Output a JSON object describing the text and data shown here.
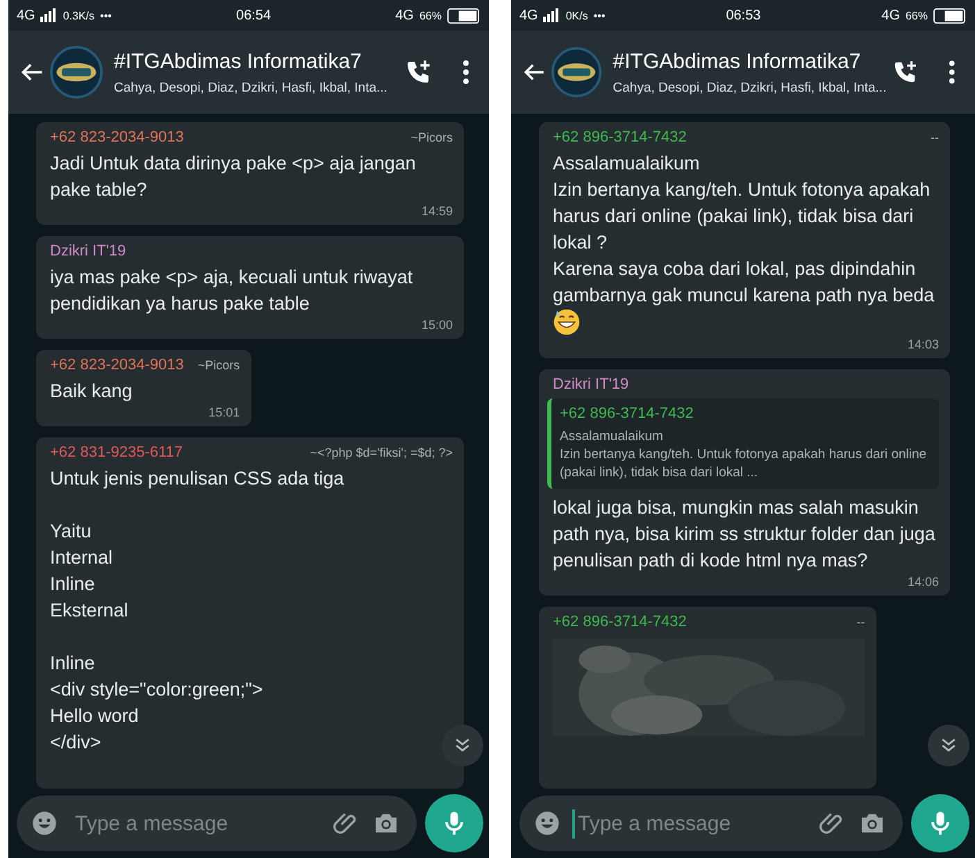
{
  "phones": [
    {
      "status_bar": {
        "network": "4G",
        "speed": "0.3K/s",
        "dots": "•••",
        "time": "06:54",
        "network_right": "4G",
        "battery": "66%"
      },
      "header": {
        "title": "#ITGAbdimas Informatika7",
        "subtitle": "Cahya, Desopi, Diaz, Dzikri, Hasfi, Ikbal, Inta..."
      },
      "messages": [
        {
          "kind": "text",
          "sender": "+62 823-2034-9013",
          "color": "#e0735a",
          "push_name": "~Picors",
          "text": "Jadi Untuk data dirinya pake <p> aja jangan pake table?",
          "time": "14:59"
        },
        {
          "kind": "text",
          "sender": "Dzikri IT'19",
          "color": "#d08ac9",
          "text": "iya mas pake <p> aja, kecuali untuk riwayat pendidikan ya harus pake table",
          "time": "15:00"
        },
        {
          "kind": "text",
          "sender": "+62 823-2034-9013",
          "color": "#e0735a",
          "push_name": "~Picors",
          "text": "Baik kang",
          "time": "15:01"
        },
        {
          "kind": "text",
          "sender": "+62 831-9235-6117",
          "color": "#e2585a",
          "push_name": "~<?php $d='fiksi'; =$d; ?>",
          "text": "Untuk jenis penulisan CSS ada tiga\n\nYaitu\nInternal\nInline\nEksternal\n\nInline\n<div style=\"color:green;\">\nHello word\n</div>"
        }
      ],
      "composer": {
        "placeholder": "Type a message",
        "focused": false
      }
    },
    {
      "status_bar": {
        "network": "4G",
        "speed": "0K/s",
        "dots": "•••",
        "time": "06:53",
        "network_right": "4G",
        "battery": "66%"
      },
      "header": {
        "title": "#ITGAbdimas Informatika7",
        "subtitle": "Cahya, Desopi, Diaz, Dzikri, Hasfi, Ikbal, Inta..."
      },
      "messages": [
        {
          "kind": "text",
          "sender": "+62 896-3714-7432",
          "color": "#3fb950",
          "push_name": "--",
          "text": "Assalamualaikum\nIzin bertanya kang/teh. Untuk fotonya apakah harus dari online (pakai link), tidak bisa dari lokal ?\nKarena saya coba dari lokal, pas dipindahin gambarnya gak muncul karena path nya beda",
          "time": "14:03",
          "has_emoji": true
        },
        {
          "kind": "text",
          "sender": "Dzikri IT'19",
          "color": "#d08ac9",
          "quote": {
            "sender": "+62 896-3714-7432",
            "color": "#3fb950",
            "text": "Assalamualaikum\nIzin bertanya kang/teh. Untuk fotonya apakah harus dari online (pakai link), tidak bisa dari lokal ..."
          },
          "text": "lokal juga bisa, mungkin mas salah masukin path nya, bisa kirim ss struktur folder dan juga penulisan path di kode html nya mas?",
          "time": "14:06"
        },
        {
          "sender": "+62 896-3714-7432",
          "color": "#3fb950",
          "push_name": "--"
        }
      ],
      "composer": {
        "placeholder": "Type a message",
        "focused": true
      }
    }
  ]
}
